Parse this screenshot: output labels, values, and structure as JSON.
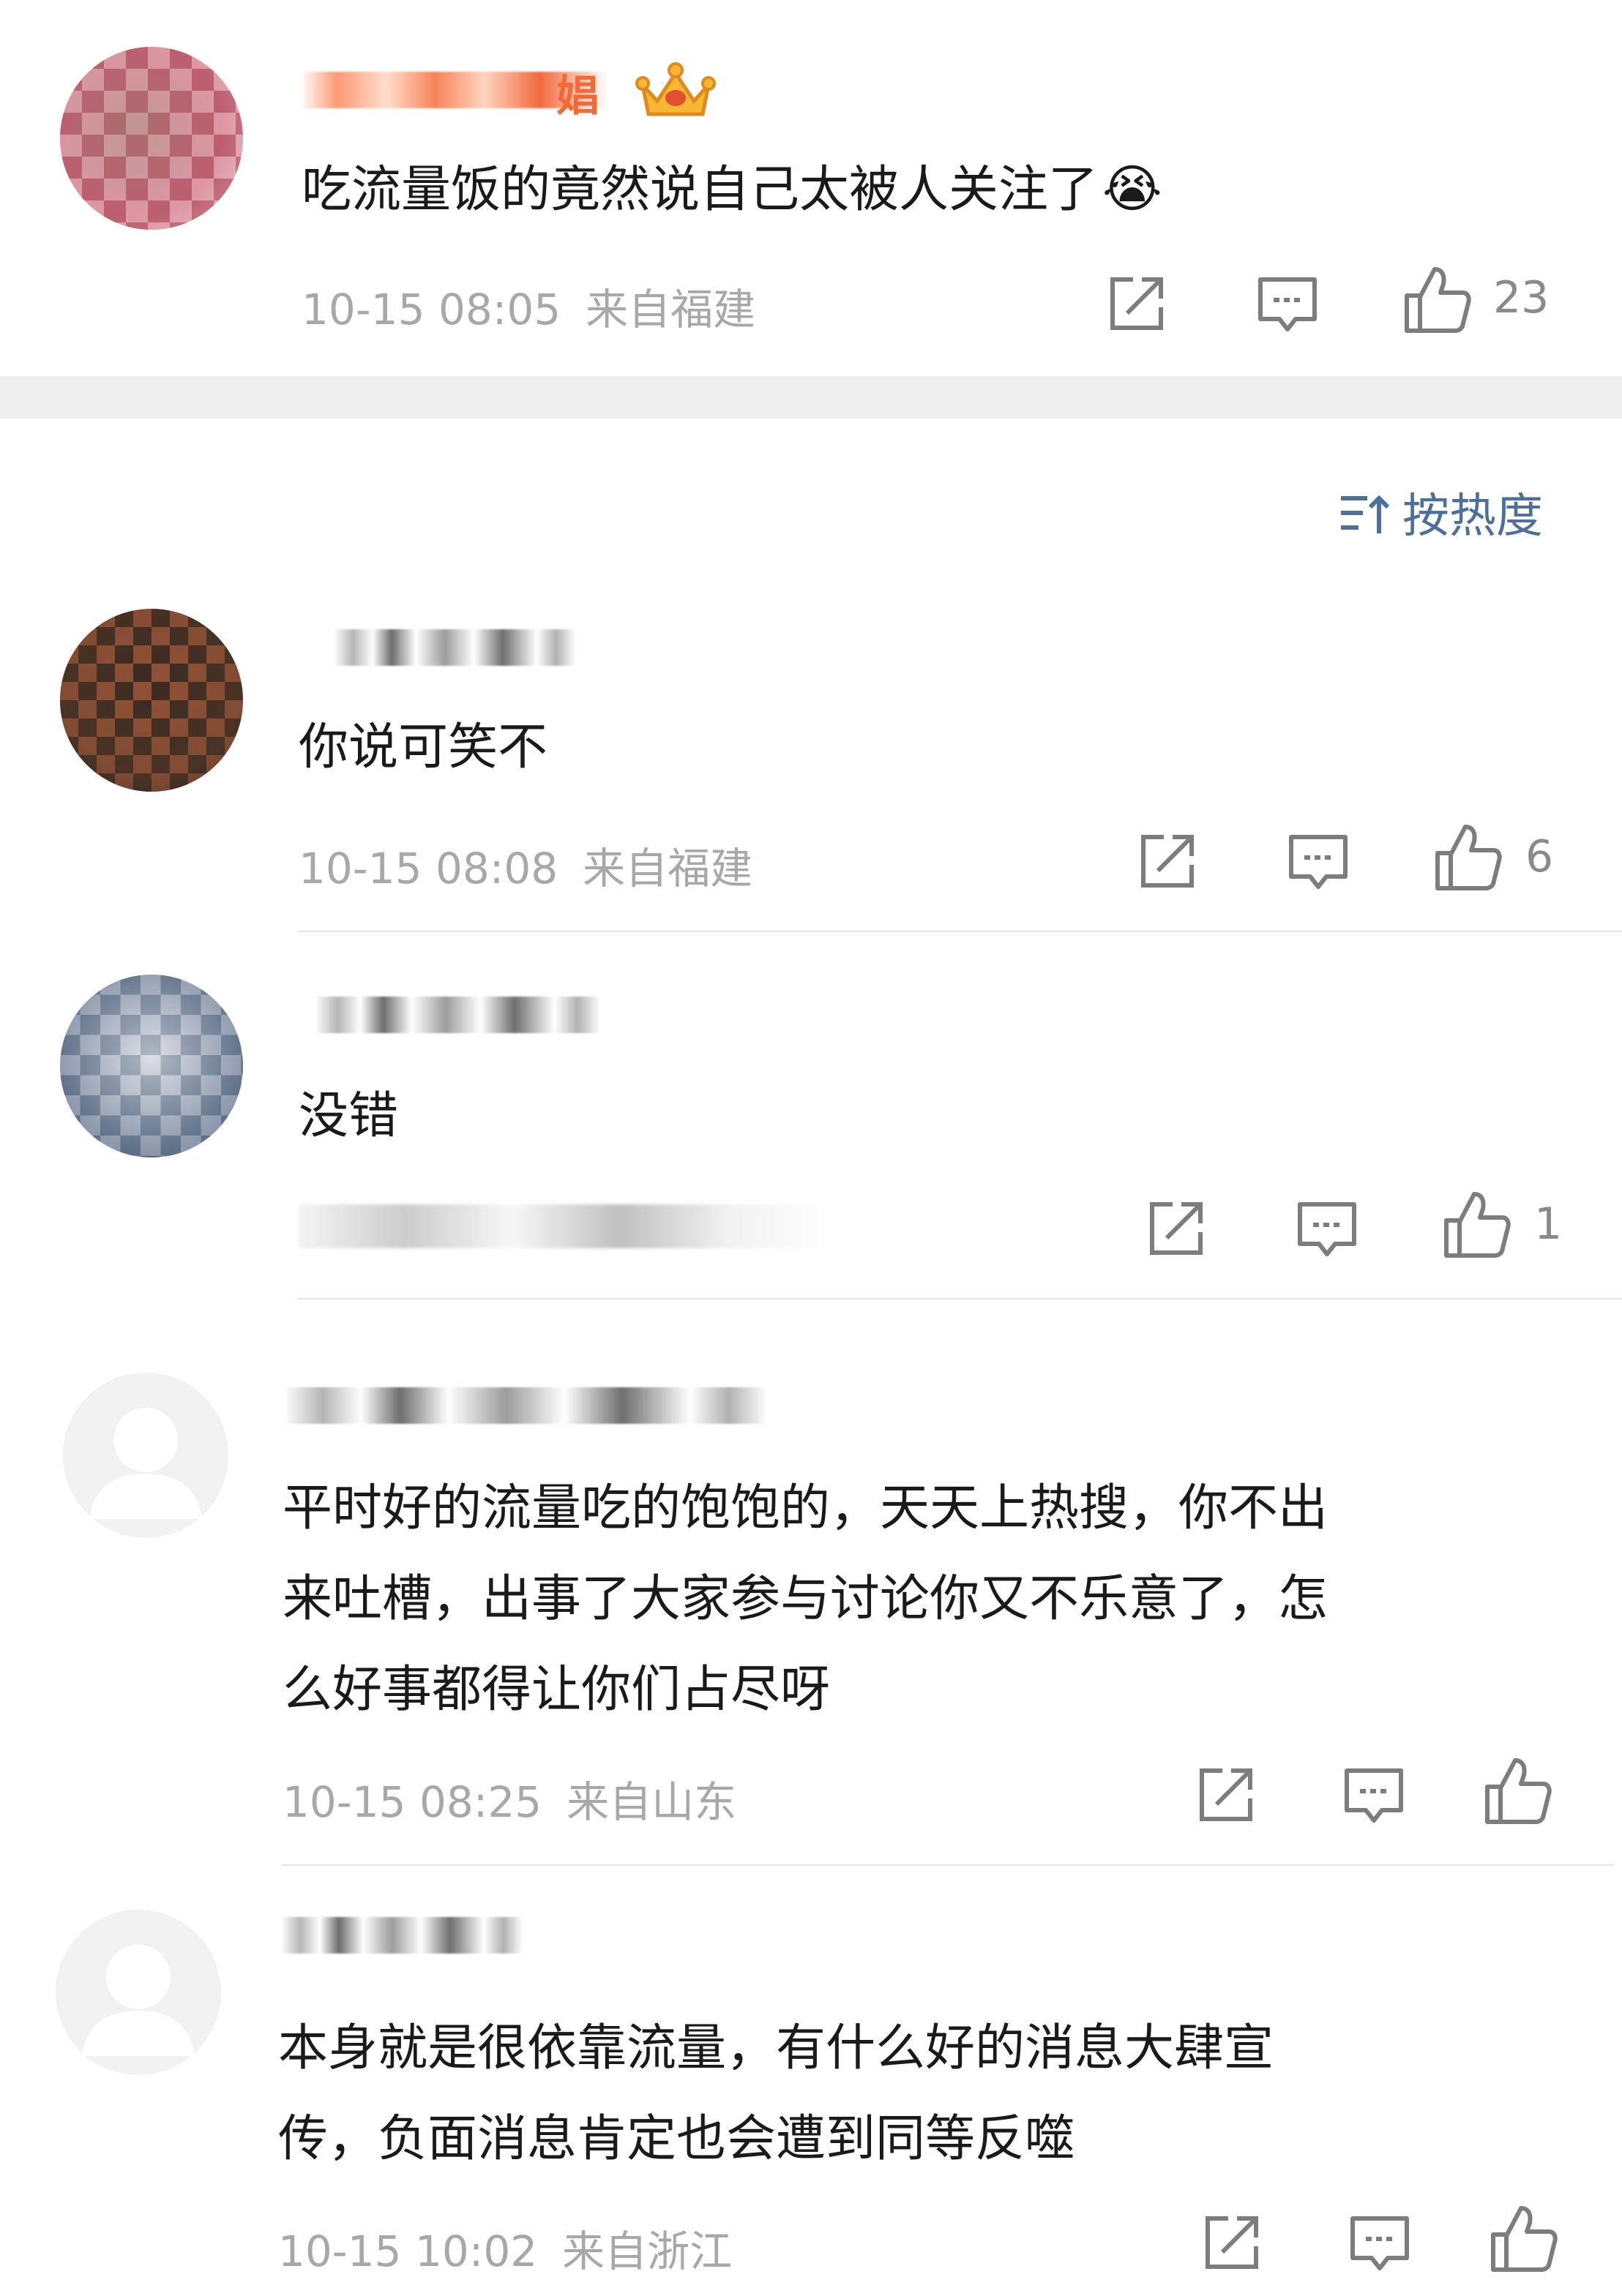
{
  "top_comment": {
    "name_fragment": "娼",
    "text": "吃流量饭的竟然说自己太被人关注了",
    "emoji": "😭",
    "time": "10-15 08:05",
    "location": "来自福建",
    "likes": "23"
  },
  "sort": {
    "label": "按热度"
  },
  "replies": [
    {
      "text": "你说可笑不",
      "time": "10-15 08:08",
      "location": "来自福建",
      "likes": "6"
    },
    {
      "text": "没错",
      "likes": "1"
    },
    {
      "text_lines": [
        "平时好的流量吃的饱饱的，天天上热搜，你不出",
        "来吐槽，出事了大家参与讨论你又不乐意了，怎",
        "么好事都得让你们占尽呀"
      ],
      "time": "10-15 08:25",
      "location": "来自山东"
    },
    {
      "text_lines": [
        "本身就是很依靠流量，有什么好的消息大肆宣",
        "传，负面消息肯定也会遭到同等反噬"
      ],
      "time": "10-15 10:02",
      "location": "来自浙江"
    }
  ],
  "icons": [
    "share-icon",
    "comment-icon",
    "like-icon",
    "sort-icon",
    "crown-icon",
    "default-avatar-icon"
  ]
}
